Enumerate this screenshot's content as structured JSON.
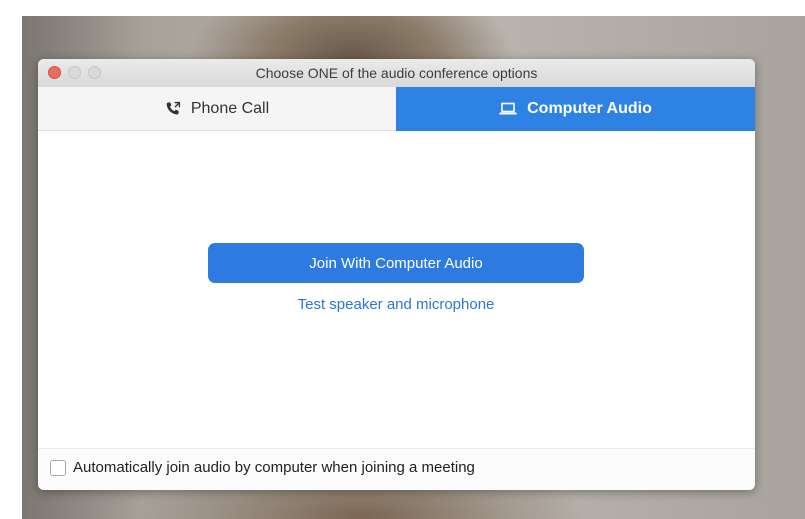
{
  "window": {
    "title": "Choose ONE of the audio conference options"
  },
  "tabs": [
    {
      "label": "Phone Call",
      "icon": "phone-icon",
      "selected": false
    },
    {
      "label": "Computer Audio",
      "icon": "laptop-icon",
      "selected": true
    }
  ],
  "main": {
    "join_button_label": "Join With Computer Audio",
    "test_link_label": "Test speaker and microphone"
  },
  "footer": {
    "auto_join_label": "Automatically join audio by computer when joining a meeting",
    "auto_join_checked": false
  },
  "colors": {
    "accent": "#2d82e3",
    "button": "#2d7be0",
    "link": "#2a78d6",
    "close": "#ed6a5e"
  }
}
